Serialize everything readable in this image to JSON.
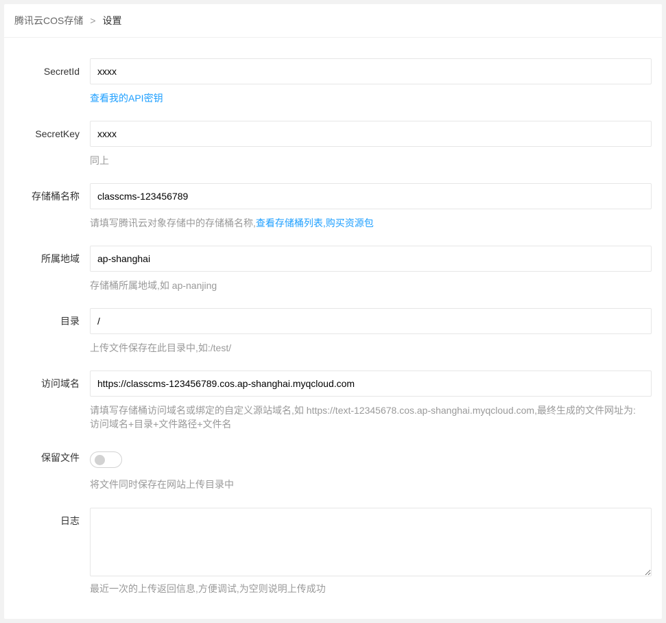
{
  "breadcrumb": {
    "parent": "腾讯云COS存储",
    "separator": ">",
    "current": "设置"
  },
  "form": {
    "secret_id": {
      "label": "SecretId",
      "value": "xxxx",
      "help_link": "查看我的API密钥"
    },
    "secret_key": {
      "label": "SecretKey",
      "value": "xxxx",
      "help": "同上"
    },
    "bucket": {
      "label": "存储桶名称",
      "value": "classcms-123456789",
      "help_prefix": "请填写腾讯云对象存储中的存储桶名称,",
      "help_link1": "查看存储桶列表",
      "help_sep": ",",
      "help_link2": "购买资源包"
    },
    "region": {
      "label": "所属地域",
      "value": "ap-shanghai",
      "help": "存储桶所属地域,如 ap-nanjing"
    },
    "directory": {
      "label": "目录",
      "value": "/",
      "help": "上传文件保存在此目录中,如:/test/"
    },
    "domain": {
      "label": "访问域名",
      "value": "https://classcms-123456789.cos.ap-shanghai.myqcloud.com",
      "help_line1": "请填写存储桶访问域名或绑定的自定义源站域名,如 https://text-12345678.cos.ap-shanghai.myqcloud.com,最终生成的文件网址为:",
      "help_line2": "访问域名+目录+文件路径+文件名"
    },
    "keep_file": {
      "label": "保留文件",
      "enabled": false,
      "help": "将文件同时保存在网站上传目录中"
    },
    "log": {
      "label": "日志",
      "value": "",
      "help": "最近一次的上传返回信息,方便调试,为空则说明上传成功"
    }
  }
}
